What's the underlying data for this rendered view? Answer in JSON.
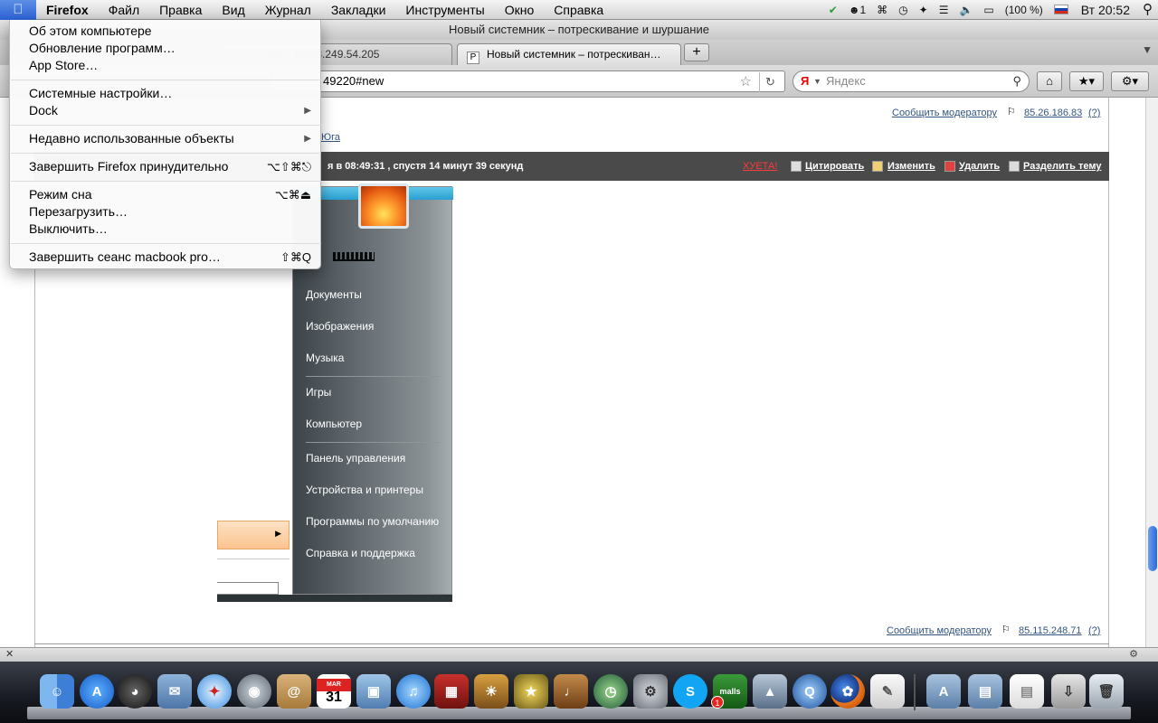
{
  "menubar": {
    "app": "Firefox",
    "items": [
      "Файл",
      "Правка",
      "Вид",
      "Журнал",
      "Закладки",
      "Инструменты",
      "Окно",
      "Справка"
    ],
    "status_count": "1",
    "battery": "(100 %)",
    "clock": "Вт 20:52"
  },
  "window": {
    "title": "Новый системник – потрескивание и шуршание"
  },
  "tabs": [
    {
      "label": "…ost/…ip=78.249.54.205",
      "active": false
    },
    {
      "label": "Новый системник – потрескиван…",
      "active": true
    }
  ],
  "tab_favicon": "P",
  "new_tab": "+",
  "navbar": {
    "url": "49220#new",
    "search_placeholder": "Яндекс",
    "search_engine_glyph": "Я"
  },
  "content": {
    "report_mod_top": "Сообщить модератору",
    "ip_top": "85.26.186.83",
    "ip_top_q": "(?)",
    "breadcrumb": "Юга",
    "post_date": "я в 08:49:31 , спустя 14 минут 39 секунд",
    "actions": {
      "bad": "ХУЕТА!",
      "quote": "Цитировать",
      "edit": "Изменить",
      "delete": "Удалить",
      "split": "Разделить тему"
    },
    "report_mod_bottom": "Сообщить модератору",
    "ip_bottom": "85.115.248.71",
    "ip_bottom_q": "(?)"
  },
  "start_menu": {
    "items": [
      "Документы",
      "Изображения",
      "Музыка",
      "Игры",
      "Компьютер",
      "Панель управления",
      "Устройства и принтеры",
      "Программы по умолчанию",
      "Справка и поддержка"
    ]
  },
  "apple_menu": {
    "about": "Об этом компьютере",
    "software_update": "Обновление программ…",
    "app_store": "App Store…",
    "system_prefs": "Системные настройки…",
    "dock": "Dock",
    "recent": "Недавно использованные объекты",
    "force_quit": "Завершить Firefox принудительно",
    "force_quit_shortcut": "⌥⇧⌘⎋",
    "sleep": "Режим сна",
    "sleep_shortcut": "⌥⌘⏏",
    "restart": "Перезагрузить…",
    "shutdown": "Выключить…",
    "logout": "Завершить сеанс macbook pro…",
    "logout_shortcut": "⇧⌘Q"
  },
  "dock": {
    "calendar_month": "MAR",
    "calendar_day": "31",
    "malls_label": "malls",
    "badge": "1"
  },
  "colors": {
    "accent_blue": "#2c62d6",
    "post_header_bg": "#4a4a4a",
    "bad_label": "#ff3b3b",
    "link": "#33557f"
  }
}
